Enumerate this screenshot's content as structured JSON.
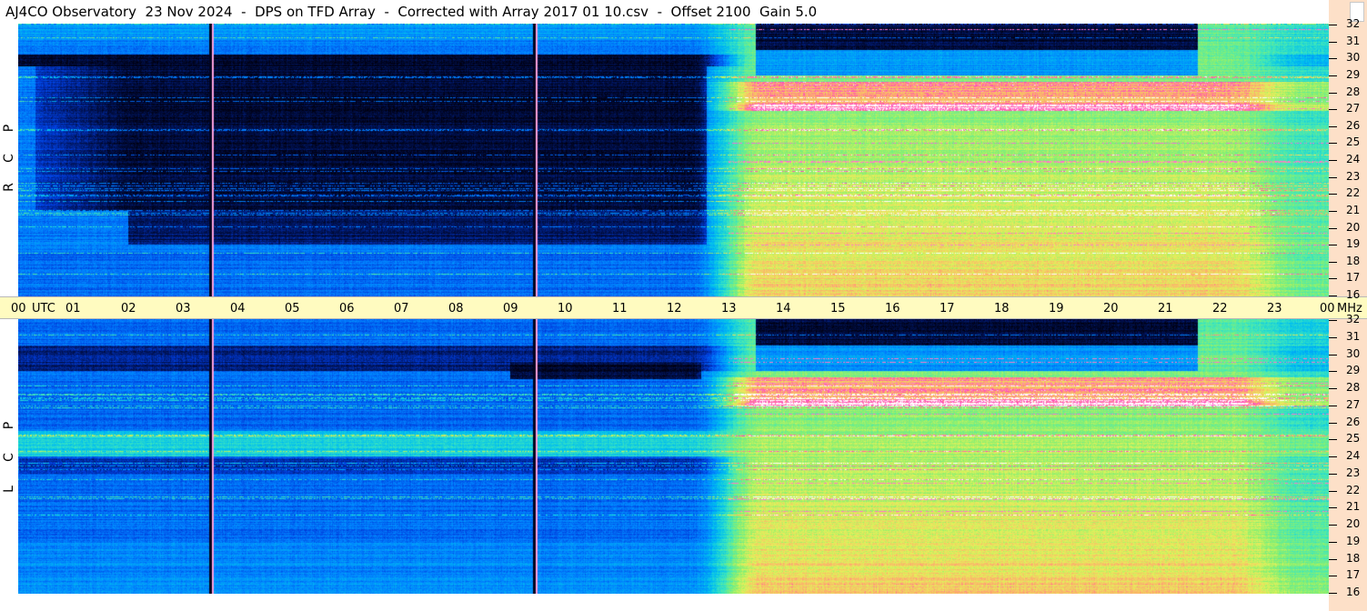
{
  "title": "AJ4CO Observatory  23 Nov 2024  -  DPS on TFD Array  -  Corrected with Array 2017 01 10.csv  -  Offset 2100  Gain 5.0",
  "time_axis": {
    "labels": [
      "00",
      "UTC",
      "01",
      "02",
      "03",
      "04",
      "05",
      "06",
      "07",
      "08",
      "09",
      "10",
      "11",
      "12",
      "13",
      "14",
      "15",
      "16",
      "17",
      "18",
      "19",
      "20",
      "21",
      "22",
      "23",
      "00",
      "MHz"
    ]
  },
  "panels": [
    {
      "letters": [
        "R",
        "C",
        "P"
      ]
    },
    {
      "letters": [
        "L",
        "C",
        "P"
      ]
    }
  ],
  "freq_labels": [
    "32",
    "31",
    "30",
    "29",
    "28",
    "27",
    "26",
    "25",
    "24",
    "23",
    "22",
    "21",
    "20",
    "19",
    "18",
    "17",
    "16"
  ],
  "chart_data": {
    "type": "heatmap",
    "title": "AJ4CO Observatory  23 Nov 2024  -  DPS on TFD Array  -  Corrected with Array 2017 01 10.csv  -  Offset 2100  Gain 5.0",
    "x": {
      "label": "UTC",
      "ticks": [
        "00",
        "01",
        "02",
        "03",
        "04",
        "05",
        "06",
        "07",
        "08",
        "09",
        "10",
        "11",
        "12",
        "13",
        "14",
        "15",
        "16",
        "17",
        "18",
        "19",
        "20",
        "21",
        "22",
        "23",
        "00"
      ],
      "range_hours": [
        0,
        24
      ]
    },
    "y": {
      "label": "MHz",
      "ticks": [
        32,
        31,
        30,
        29,
        28,
        27,
        26,
        25,
        24,
        23,
        22,
        21,
        20,
        19,
        18,
        17,
        16
      ],
      "range": [
        16,
        32
      ]
    },
    "series": [
      {
        "name": "RCP"
      },
      {
        "name": "LCP"
      }
    ],
    "colors": [
      "#000010",
      "#002a8a",
      "#0060ff",
      "#00a8ff",
      "#30e8c0",
      "#a0f070",
      "#f8f060",
      "#ff9a60",
      "#ff40c0",
      "#ffffff"
    ]
  }
}
